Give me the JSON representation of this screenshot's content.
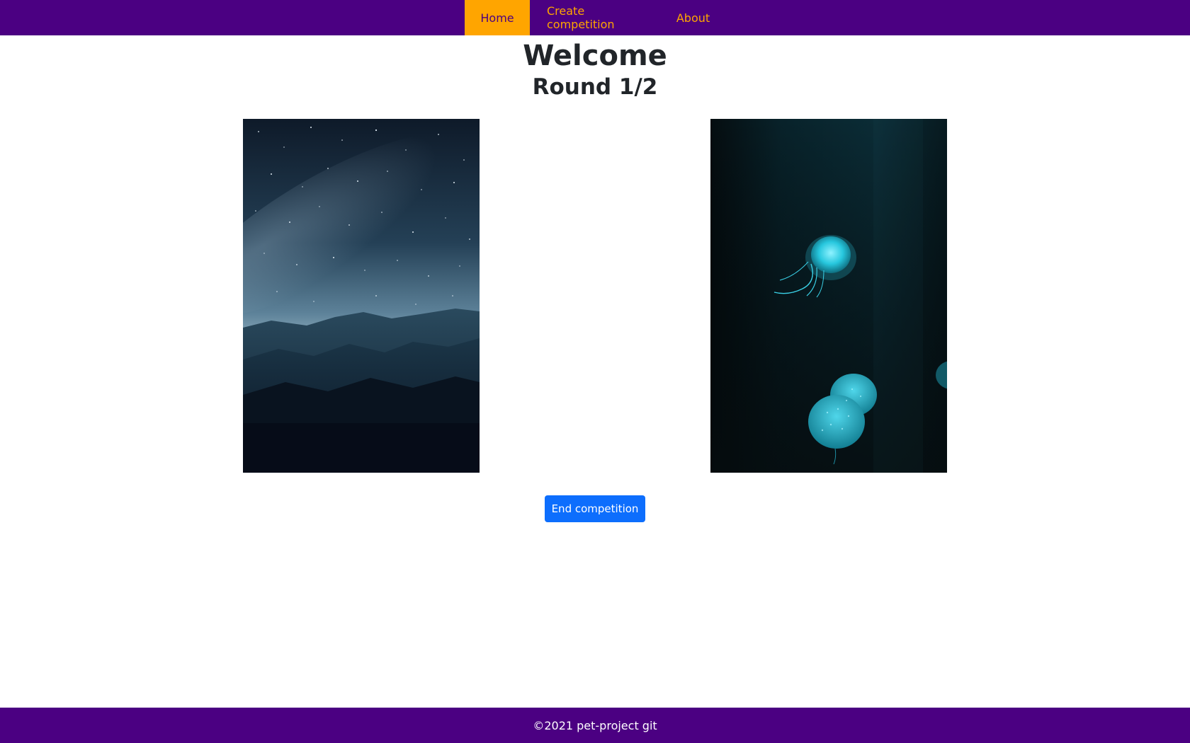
{
  "nav": {
    "items": [
      {
        "label": "Home",
        "active": true
      },
      {
        "label": "Create competition",
        "active": false
      },
      {
        "label": "About",
        "active": false
      }
    ]
  },
  "main": {
    "title": "Welcome",
    "round": "Round 1/2",
    "images": [
      {
        "subject": "starry-sky-mountains"
      },
      {
        "subject": "jellyfish-underwater"
      }
    ],
    "end_button_label": "End competition"
  },
  "footer": {
    "text": "©2021 pet-project git"
  },
  "colors": {
    "nav_bg": "#4b0082",
    "nav_text": "#ffa500",
    "nav_active_bg": "#ffa500",
    "button_bg": "#0d6efd"
  }
}
